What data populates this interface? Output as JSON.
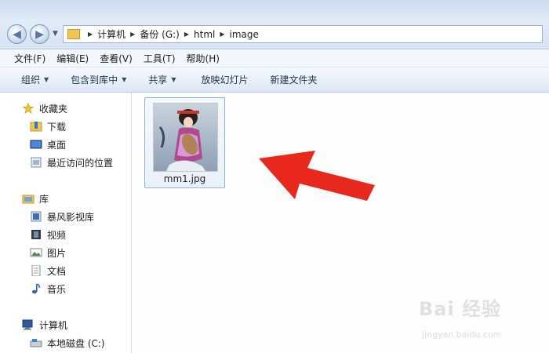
{
  "address": {
    "crumbs": [
      "计算机",
      "备份 (G:)",
      "html",
      "image"
    ]
  },
  "menu": [
    "文件(F)",
    "编辑(E)",
    "查看(V)",
    "工具(T)",
    "帮助(H)"
  ],
  "toolbar": {
    "organize": "组织",
    "include_library": "包含到库中",
    "share": "共享",
    "slideshow": "放映幻灯片",
    "new_folder": "新建文件夹"
  },
  "nav": {
    "favorites": "收藏夹",
    "downloads": "下载",
    "desktop": "桌面",
    "recent": "最近访问的位置",
    "libraries": "库",
    "storm_library": "暴风影视库",
    "videos": "视频",
    "pictures": "图片",
    "documents": "文档",
    "music": "音乐",
    "computer": "计算机",
    "local_disk": "本地磁盘 (C:)"
  },
  "files": [
    {
      "name": "mm1.jpg"
    }
  ],
  "watermark": {
    "text": "Bai 经验",
    "url": "jingyan.baidu.com"
  },
  "colors": {
    "arrow": "#e8281c",
    "selection_border": "#8fb2d8"
  }
}
